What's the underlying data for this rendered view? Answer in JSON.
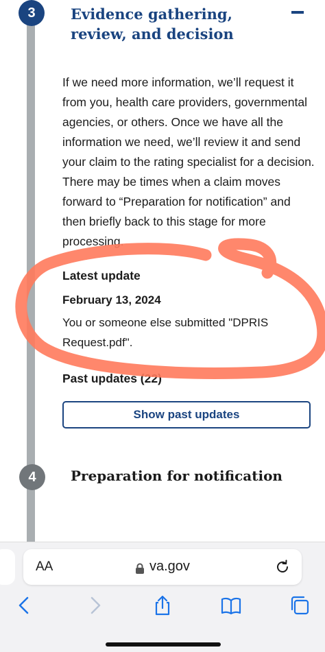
{
  "step3": {
    "number": "3",
    "title": "Evidence gathering, review, and decision",
    "description": "If we need more information, we’ll request it from you, health care providers, governmental agencies, or others. Once we have all the information we need, we’ll review it and send your claim to the rating specialist for a decision. There may be times when a claim moves forward to “Preparation for notification” and then briefly back to this stage for more processing."
  },
  "latest_update": {
    "heading": "Latest update",
    "date": "February 13, 2024",
    "text": "You or someone else submitted \"DPRIS Request.pdf\"."
  },
  "past_updates": {
    "heading": "Past updates (22)",
    "button_label": "Show past updates"
  },
  "step4": {
    "number": "4",
    "title": "Preparation for notification"
  },
  "browser": {
    "text_size_label": "AA",
    "domain": "va.gov"
  },
  "colors": {
    "primary": "#1a4480",
    "step_inactive": "#71767a",
    "track": "#a9aeb1",
    "annotation": "#ff7a5c"
  },
  "icons": {
    "collapse": "minus-icon",
    "lock": "lock-icon",
    "reload": "reload-icon",
    "back": "chevron-left-icon",
    "forward": "chevron-right-icon",
    "share": "share-icon",
    "bookmarks": "book-icon",
    "tabs": "tabs-icon"
  }
}
